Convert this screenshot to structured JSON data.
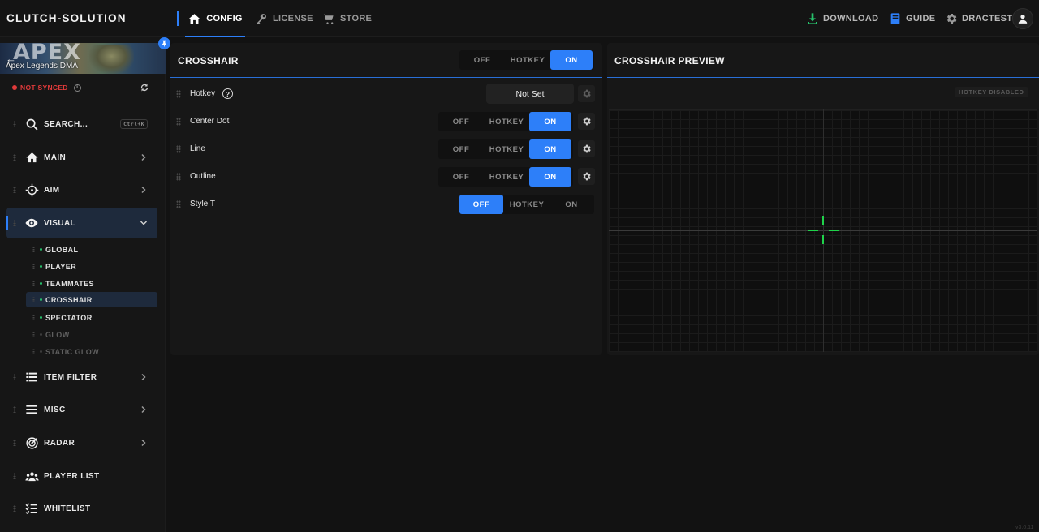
{
  "app": {
    "brand": "CLUTCH-SOLUTION",
    "version": "v3.0.11"
  },
  "topnav": {
    "tabs": [
      {
        "label": "CONFIG",
        "icon": "home-icon",
        "active": true
      },
      {
        "label": "LICENSE",
        "icon": "key-icon",
        "active": false
      },
      {
        "label": "STORE",
        "icon": "cart-icon",
        "active": false
      }
    ],
    "right": [
      {
        "label": "DOWNLOAD",
        "icon": "download-icon",
        "color": "#27c26c"
      },
      {
        "label": "GUIDE",
        "icon": "book-icon",
        "color": "#2d7ff9"
      },
      {
        "label": "DRACTEST",
        "icon": "gear-icon",
        "color": "#9a9a9a"
      }
    ]
  },
  "game": {
    "banner_logo": "APEX",
    "name": "Apex Legends DMA"
  },
  "sync": {
    "status": "NOT SYNCED"
  },
  "sidebar": {
    "search": {
      "label": "SEARCH...",
      "shortcut": "Ctrl+K"
    },
    "items": [
      {
        "label": "MAIN",
        "icon": "home-icon"
      },
      {
        "label": "AIM",
        "icon": "crosshair-target-icon"
      },
      {
        "label": "VISUAL",
        "icon": "eye-icon",
        "expanded": true
      },
      {
        "label": "ITEM FILTER",
        "icon": "list-icon"
      },
      {
        "label": "MISC",
        "icon": "menu-icon"
      },
      {
        "label": "RADAR",
        "icon": "radar-icon"
      },
      {
        "label": "PLAYER LIST",
        "icon": "users-icon"
      },
      {
        "label": "WHITELIST",
        "icon": "checklist-icon"
      }
    ],
    "visual_sub": [
      {
        "label": "GLOBAL",
        "enabled": true
      },
      {
        "label": "PLAYER",
        "enabled": true
      },
      {
        "label": "TEAMMATES",
        "enabled": true
      },
      {
        "label": "CROSSHAIR",
        "enabled": true,
        "active": true
      },
      {
        "label": "SPECTATOR",
        "enabled": true
      },
      {
        "label": "GLOW",
        "enabled": false
      },
      {
        "label": "STATIC GLOW",
        "enabled": false
      }
    ]
  },
  "crosshair": {
    "title": "CROSSHAIR",
    "master_toggle": {
      "off": "OFF",
      "hotkey": "HOTKEY",
      "on": "ON",
      "selected": "ON"
    },
    "rows": [
      {
        "label": "Hotkey",
        "value": "Not Set"
      },
      {
        "label": "Center Dot",
        "off": "OFF",
        "hotkey": "HOTKEY",
        "on": "ON",
        "selected": "ON"
      },
      {
        "label": "Line",
        "off": "OFF",
        "hotkey": "HOTKEY",
        "on": "ON",
        "selected": "ON"
      },
      {
        "label": "Outline",
        "off": "OFF",
        "hotkey": "HOTKEY",
        "on": "ON",
        "selected": "ON"
      },
      {
        "label": "Style T",
        "off": "OFF",
        "hotkey": "HOTKEY",
        "on": "ON",
        "selected": "OFF"
      }
    ]
  },
  "preview": {
    "title": "CROSSHAIR PREVIEW",
    "badge": "HOTKEY DISABLED",
    "crosshair_color": "#1fd34a"
  },
  "colors": {
    "accent": "#2d7ff9",
    "status_error": "#e03a3a",
    "enabled_dot": "#27c26c"
  }
}
